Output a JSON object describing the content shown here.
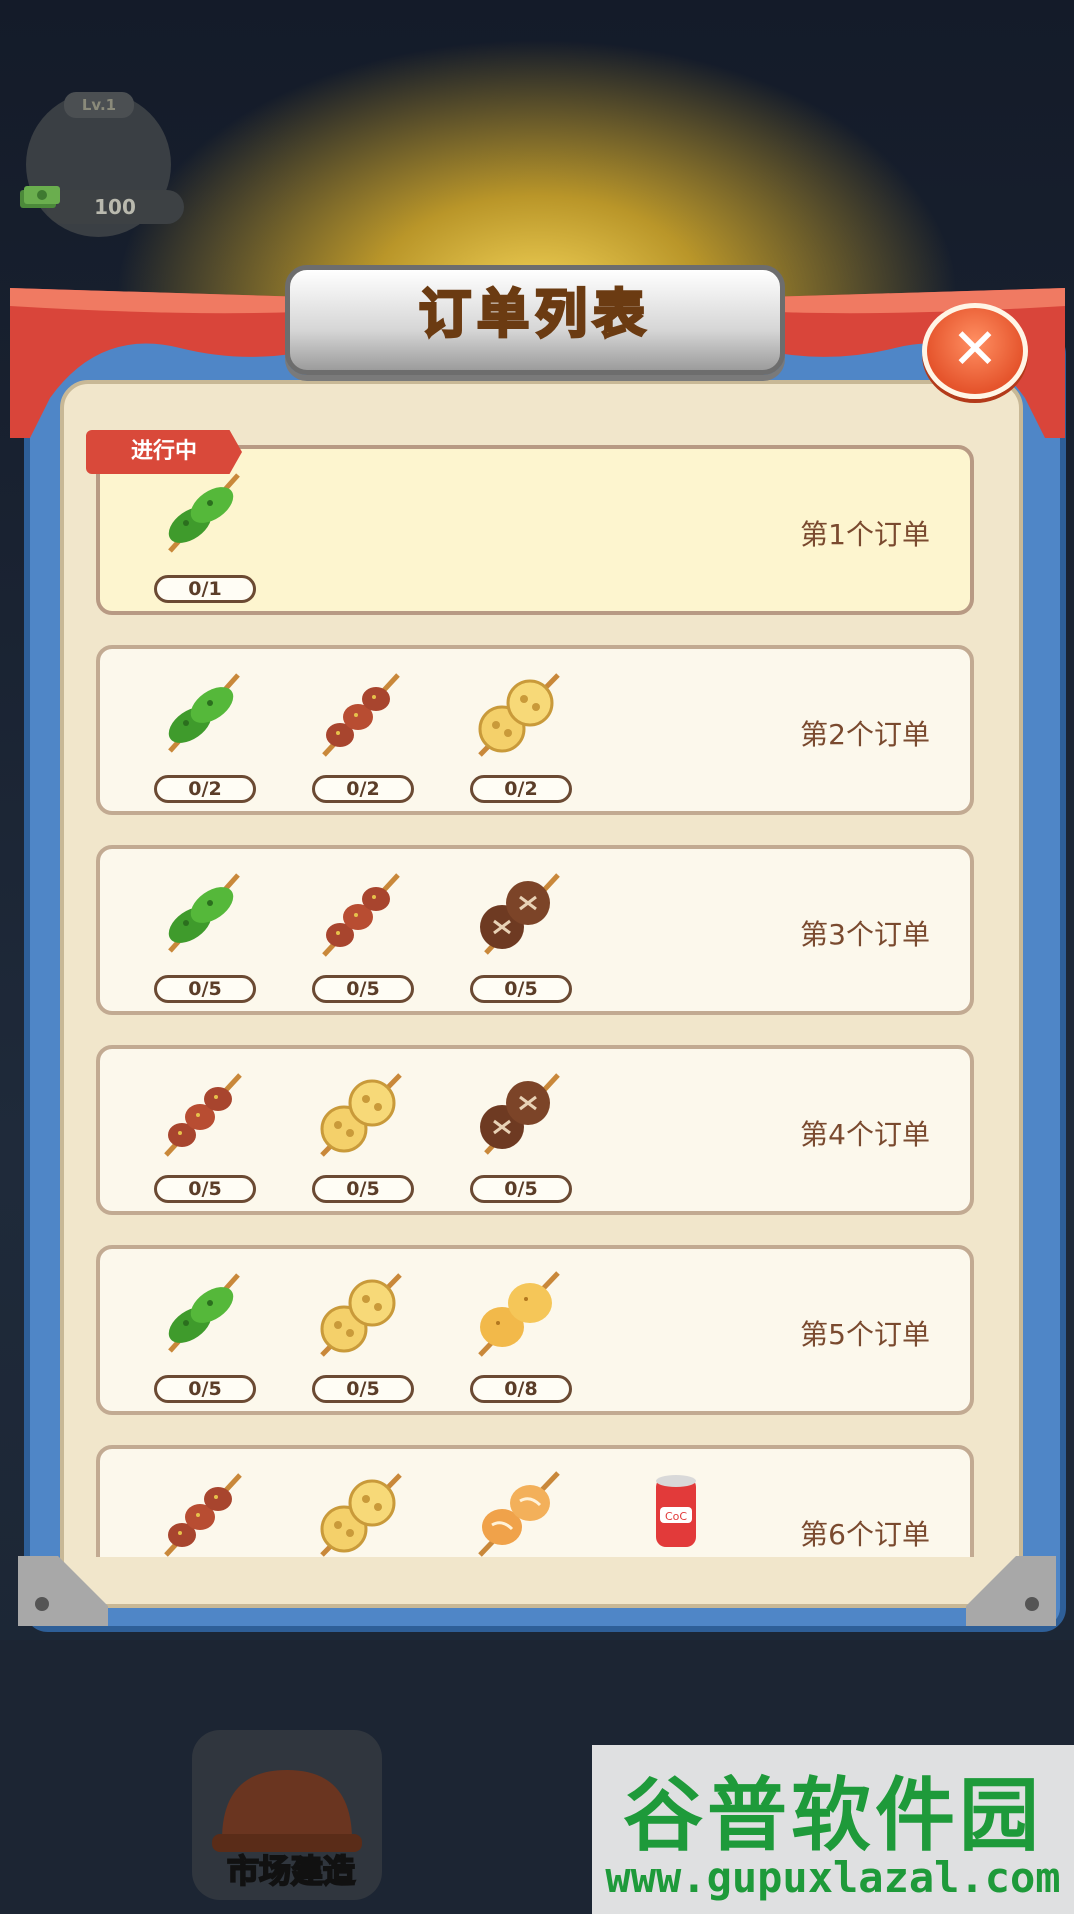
{
  "hud": {
    "level": "Lv.1",
    "money": "100"
  },
  "dialog": {
    "title": "订单列表",
    "close_icon": "close-icon",
    "status_tag": "进行中"
  },
  "orders": [
    {
      "title": "第1个订单",
      "items": [
        {
          "icon": "green-pepper-skewer-icon",
          "count": "0/1"
        }
      ]
    },
    {
      "title": "第2个订单",
      "items": [
        {
          "icon": "green-pepper-skewer-icon",
          "count": "0/2"
        },
        {
          "icon": "meat-skewer-icon",
          "count": "0/2"
        },
        {
          "icon": "lotus-root-skewer-icon",
          "count": "0/2"
        }
      ]
    },
    {
      "title": "第3个订单",
      "items": [
        {
          "icon": "green-pepper-skewer-icon",
          "count": "0/5"
        },
        {
          "icon": "meat-skewer-icon",
          "count": "0/5"
        },
        {
          "icon": "mushroom-skewer-icon",
          "count": "0/5"
        }
      ]
    },
    {
      "title": "第4个订单",
      "items": [
        {
          "icon": "meat-skewer-icon",
          "count": "0/5"
        },
        {
          "icon": "lotus-root-skewer-icon",
          "count": "0/5"
        },
        {
          "icon": "mushroom-skewer-icon",
          "count": "0/5"
        }
      ]
    },
    {
      "title": "第5个订单",
      "items": [
        {
          "icon": "green-pepper-skewer-icon",
          "count": "0/5"
        },
        {
          "icon": "lotus-root-skewer-icon",
          "count": "0/5"
        },
        {
          "icon": "potato-skewer-icon",
          "count": "0/8"
        }
      ]
    },
    {
      "title": "第6个订单",
      "items": [
        {
          "icon": "meat-skewer-icon",
          "count": ""
        },
        {
          "icon": "lotus-root-skewer-icon",
          "count": ""
        },
        {
          "icon": "bun-skewer-icon",
          "count": ""
        },
        {
          "icon": "cola-can-icon",
          "count": ""
        }
      ]
    }
  ],
  "bottom": {
    "build_label": "市场建造"
  },
  "watermark": {
    "title": "谷普软件园",
    "url": "www.gupuxlazal.com"
  },
  "colors": {
    "accent_red": "#d9493a",
    "panel_blue": "#4f86c7",
    "title_gold": "#f7d26b",
    "watermark_green": "#1e9a3a"
  }
}
